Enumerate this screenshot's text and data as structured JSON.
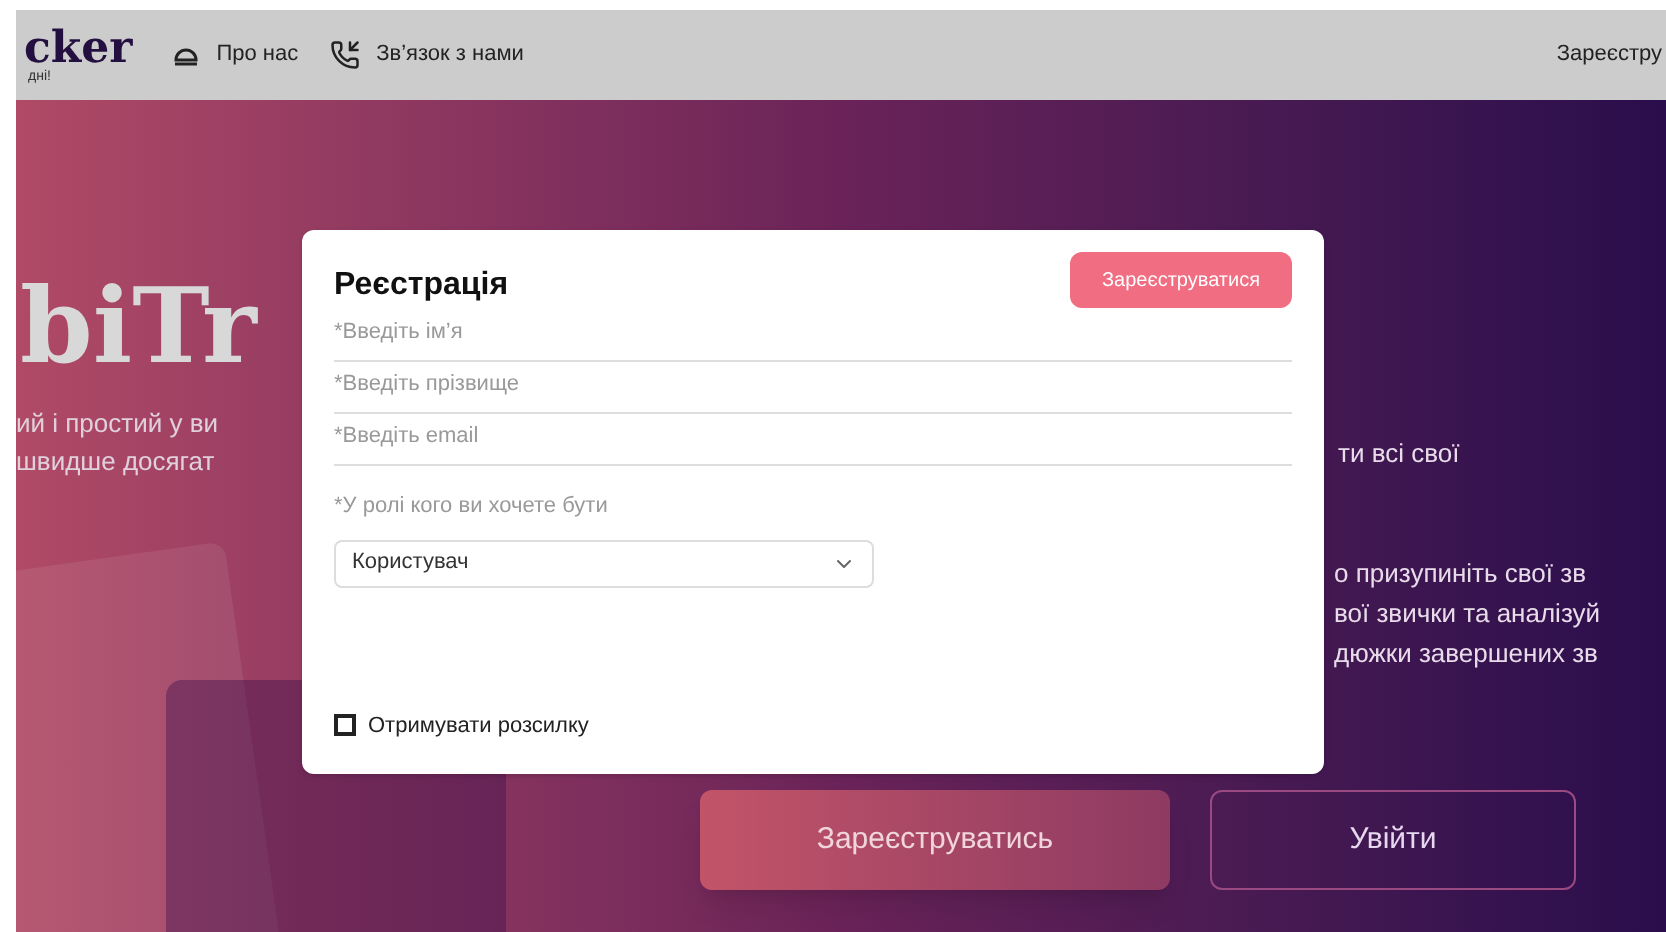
{
  "header": {
    "logo": "cker",
    "tagline": "дні!",
    "nav": [
      {
        "kind": "about",
        "label": "Про нас"
      },
      {
        "kind": "contact",
        "label": "Зв’язок з нами"
      }
    ],
    "register_link": "Зареєстру"
  },
  "hero": {
    "heading": "biTr",
    "left_lines": [
      "ий і простий у ви",
      "швидше досягат"
    ],
    "right_top": "ти всі свої",
    "right_lines": [
      "о призупиніть свої зв",
      "вої звички та аналізуй",
      "дюжки завершених зв"
    ],
    "buttons": [
      {
        "kind": "primary",
        "label": "Зареєструватись"
      },
      {
        "kind": "outline",
        "label": "Увійти"
      }
    ]
  },
  "modal": {
    "title": "Реєстрація",
    "submit": "Зареєструватися",
    "fields": [
      {
        "placeholder": "*Введіть ім’я"
      },
      {
        "placeholder": "*Введіть прізвище"
      },
      {
        "placeholder": "*Введіть email"
      }
    ],
    "role_label": "*У ролі кого ви хочете бути",
    "role_value": "Користувач",
    "newsletter": {
      "label": "Отримувати розсилку",
      "checked": false
    }
  }
}
